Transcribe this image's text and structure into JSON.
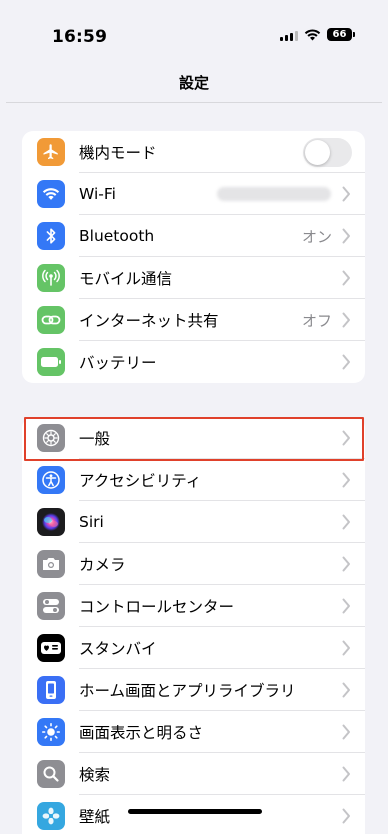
{
  "status": {
    "time": "16:59",
    "battery": "66"
  },
  "nav": {
    "title": "設定"
  },
  "group1": [
    {
      "label": "機内モード",
      "icon": "airplane-icon",
      "color": "#f19a37"
    },
    {
      "label": "Wi-Fi",
      "icon": "wifi-icon",
      "color": "#3478f6"
    },
    {
      "label": "Bluetooth",
      "icon": "bluetooth-icon",
      "color": "#3478f6",
      "value": "オン"
    },
    {
      "label": "モバイル通信",
      "icon": "antenna-icon",
      "color": "#65c466"
    },
    {
      "label": "インターネット共有",
      "icon": "link-icon",
      "color": "#65c466",
      "value": "オフ"
    },
    {
      "label": "バッテリー",
      "icon": "battery-icon",
      "color": "#65c466"
    }
  ],
  "group2": [
    {
      "label": "一般",
      "icon": "gear-icon",
      "color": "#8e8e93"
    },
    {
      "label": "アクセシビリティ",
      "icon": "accessibility-icon",
      "color": "#3478f6"
    },
    {
      "label": "Siri",
      "icon": "siri-icon",
      "color": "#1c1c1e"
    },
    {
      "label": "カメラ",
      "icon": "camera-icon",
      "color": "#8e8e93"
    },
    {
      "label": "コントロールセンター",
      "icon": "switches-icon",
      "color": "#8e8e93"
    },
    {
      "label": "スタンバイ",
      "icon": "standby-icon",
      "color": "#000000"
    },
    {
      "label": "ホーム画面とアプリライブラリ",
      "icon": "home-screen-icon",
      "color": "#3a6ff5"
    },
    {
      "label": "画面表示と明るさ",
      "icon": "brightness-icon",
      "color": "#3478f6"
    },
    {
      "label": "検索",
      "icon": "search-icon",
      "color": "#8e8e93"
    },
    {
      "label": "壁紙",
      "icon": "wallpaper-icon",
      "color": "#35a7e0"
    }
  ]
}
